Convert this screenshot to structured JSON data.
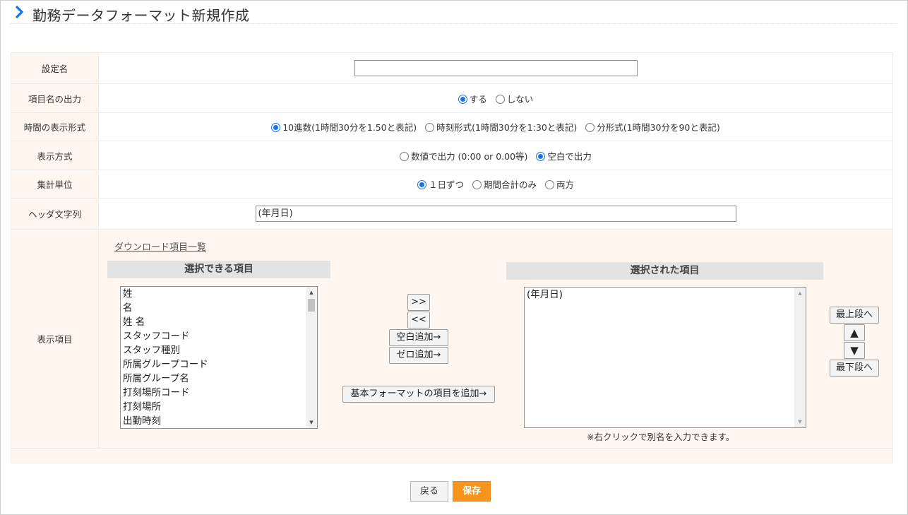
{
  "header": {
    "title": "勤務データフォーマット新規作成"
  },
  "form": {
    "setting_name": {
      "label": "設定名",
      "value": ""
    },
    "item_name_output": {
      "label": "項目名の出力",
      "options": [
        "する",
        "しない"
      ],
      "selected": "する"
    },
    "time_format": {
      "label": "時間の表示形式",
      "options": [
        "10進数(1時間30分を1.50と表記)",
        "時刻形式(1時間30分を1:30と表記)",
        "分形式(1時間30分を90と表記)"
      ],
      "selected": "10進数(1時間30分を1.50と表記)"
    },
    "display_method": {
      "label": "表示方式",
      "options": [
        "数値で出力 (0:00 or 0.00等)",
        "空白で出力"
      ],
      "selected": "空白で出力"
    },
    "aggregation_unit": {
      "label": "集計単位",
      "options": [
        "１日ずつ",
        "期間合計のみ",
        "両方"
      ],
      "selected": "１日ずつ"
    },
    "header_string": {
      "label": "ヘッダ文字列",
      "value": "(年月日)"
    },
    "display_items": {
      "label": "表示項目",
      "download_link": "ダウンロード項目一覧",
      "available_heading": "選択できる項目",
      "available_items": [
        "姓",
        "名",
        "姓 名",
        "スタッフコード",
        "スタッフ種別",
        "所属グループコード",
        "所属グループ名",
        "打刻場所コード",
        "打刻場所",
        "出勤時刻"
      ],
      "selected_heading": "選択された項目",
      "selected_items": [
        "(年月日)"
      ],
      "buttons": {
        "add": ">>",
        "remove": "<<",
        "add_blank": "空白追加→",
        "add_zero": "ゼロ追加→",
        "add_basic": "基本フォーマットの項目を追加→",
        "move_top": "最上段へ",
        "move_up": "▲",
        "move_down": "▼",
        "move_bottom": "最下段へ"
      },
      "note": "※右クリックで別名を入力できます。"
    }
  },
  "actions": {
    "back": "戻る",
    "save": "保存"
  }
}
